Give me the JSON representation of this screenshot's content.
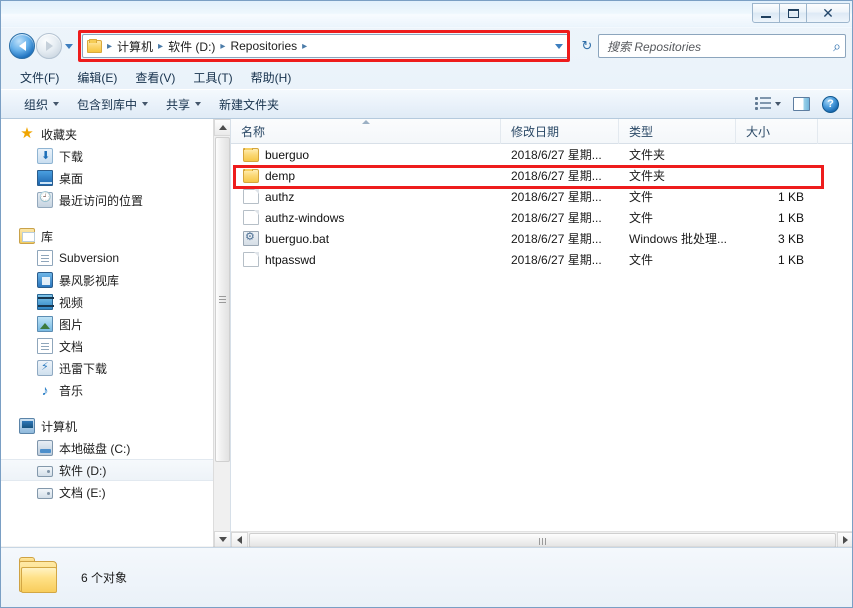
{
  "window": {
    "title": "",
    "buttons": {
      "minimize": "–",
      "maximize": "□",
      "close": "✕"
    }
  },
  "nav": {
    "back_tooltip": "后退",
    "forward_tooltip": "前进",
    "refresh_glyph": "↻",
    "dropdown_glyph": "▾"
  },
  "address": {
    "crumbs": [
      "计算机",
      "软件 (D:)",
      "Repositories"
    ],
    "separator": "▸",
    "highlight_color": "#ee1c1c"
  },
  "search": {
    "placeholder": "搜索 Repositories",
    "icon": "search-icon",
    "glyph": "⌕"
  },
  "menu": {
    "items": [
      {
        "label": "文件(F)"
      },
      {
        "label": "编辑(E)"
      },
      {
        "label": "查看(V)"
      },
      {
        "label": "工具(T)"
      },
      {
        "label": "帮助(H)"
      }
    ]
  },
  "toolbar": {
    "items": [
      {
        "label": "组织",
        "has_caret": true
      },
      {
        "label": "包含到库中",
        "has_caret": true
      },
      {
        "label": "共享",
        "has_caret": true
      },
      {
        "label": "新建文件夹",
        "has_caret": false
      }
    ],
    "views_icon": "views-icon",
    "preview_pane_icon": "preview-pane-icon",
    "help_icon": "help-icon",
    "help_glyph": "?"
  },
  "sidebar": {
    "groups": [
      {
        "header": {
          "label": "收藏夹",
          "icon": "star-icon"
        },
        "items": [
          {
            "label": "下载",
            "icon": "download-icon"
          },
          {
            "label": "桌面",
            "icon": "desktop-icon"
          },
          {
            "label": "最近访问的位置",
            "icon": "recent-places-icon"
          }
        ]
      },
      {
        "header": {
          "label": "库",
          "icon": "library-icon"
        },
        "items": [
          {
            "label": "Subversion",
            "icon": "document-library-icon"
          },
          {
            "label": "暴风影视库",
            "icon": "blue-app-icon"
          },
          {
            "label": "视频",
            "icon": "video-library-icon"
          },
          {
            "label": "图片",
            "icon": "pictures-library-icon"
          },
          {
            "label": "文档",
            "icon": "documents-library-icon"
          },
          {
            "label": "迅雷下载",
            "icon": "thunder-download-icon"
          },
          {
            "label": "音乐",
            "icon": "music-library-icon"
          }
        ]
      },
      {
        "header": {
          "label": "计算机",
          "icon": "computer-icon"
        },
        "items": [
          {
            "label": "本地磁盘 (C:)",
            "icon": "local-disk-icon",
            "selected": false
          },
          {
            "label": "软件 (D:)",
            "icon": "drive-icon",
            "selected": true
          },
          {
            "label": "文档 (E:)",
            "icon": "drive-icon",
            "selected": false
          }
        ]
      }
    ]
  },
  "filelist": {
    "columns": [
      {
        "label": "名称",
        "sorted": true,
        "sort_dir": "asc"
      },
      {
        "label": "修改日期",
        "sorted": false
      },
      {
        "label": "类型",
        "sorted": false
      },
      {
        "label": "大小",
        "sorted": false
      }
    ],
    "rows": [
      {
        "name": "buerguo",
        "date": "2018/6/27 星期...",
        "type": "文件夹",
        "size": "",
        "icon": "folder-icon",
        "highlighted": false
      },
      {
        "name": "demp",
        "date": "2018/6/27 星期...",
        "type": "文件夹",
        "size": "",
        "icon": "folder-icon",
        "highlighted": true
      },
      {
        "name": "authz",
        "date": "2018/6/27 星期...",
        "type": "文件",
        "size": "1 KB",
        "icon": "file-icon",
        "highlighted": false
      },
      {
        "name": "authz-windows",
        "date": "2018/6/27 星期...",
        "type": "文件",
        "size": "1 KB",
        "icon": "file-icon",
        "highlighted": false
      },
      {
        "name": "buerguo.bat",
        "date": "2018/6/27 星期...",
        "type": "Windows 批处理...",
        "size": "3 KB",
        "icon": "batch-file-icon",
        "highlighted": false
      },
      {
        "name": "htpasswd",
        "date": "2018/6/27 星期...",
        "type": "文件",
        "size": "1 KB",
        "icon": "file-icon",
        "highlighted": false
      }
    ]
  },
  "statusbar": {
    "item_count_text": "6 个对象",
    "icon": "folder-large-icon"
  }
}
